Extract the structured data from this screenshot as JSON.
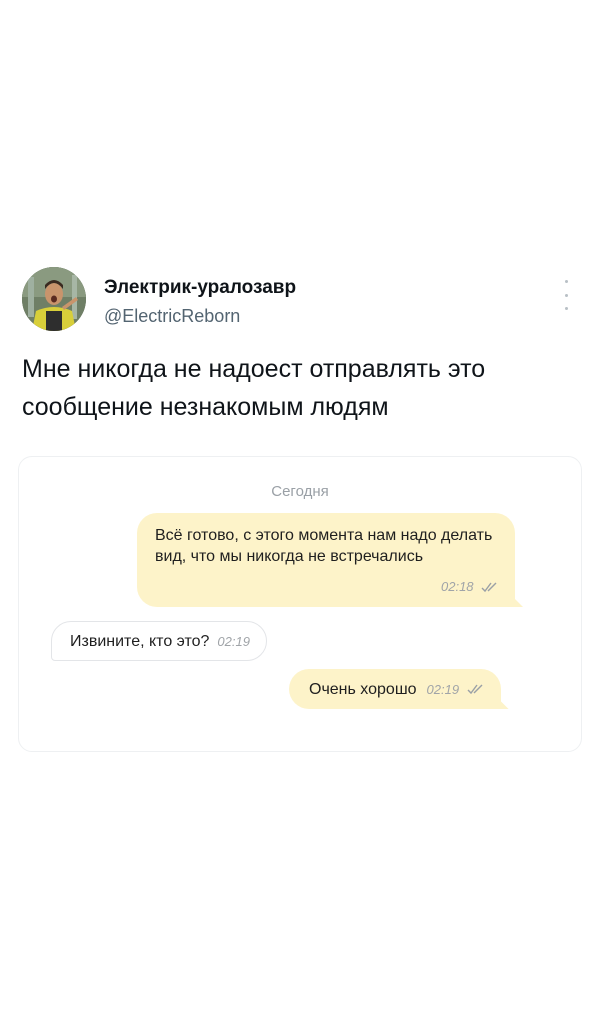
{
  "tweet": {
    "author_name": "Электрик-уралозавр",
    "author_handle": "@ElectricReborn",
    "text": "Мне никогда не надоест отправлять это сообщение незнакомым людям",
    "avatar_icon": "person-avatar",
    "more_icon": "more-vertical-icon"
  },
  "chat": {
    "date_label": "Сегодня",
    "messages": [
      {
        "direction": "outgoing",
        "text": "Всё готово, с этого момента нам надо делать вид, что мы никогда не встречались",
        "time": "02:18",
        "read_icon": "double-check-icon"
      },
      {
        "direction": "incoming",
        "text": "Извините, кто это?",
        "time": "02:19"
      },
      {
        "direction": "outgoing",
        "text": "Очень хорошо",
        "time": "02:19",
        "read_icon": "double-check-icon"
      }
    ],
    "colors": {
      "outgoing_bubble": "#fdf3c9",
      "incoming_bubble": "#ffffff"
    }
  }
}
